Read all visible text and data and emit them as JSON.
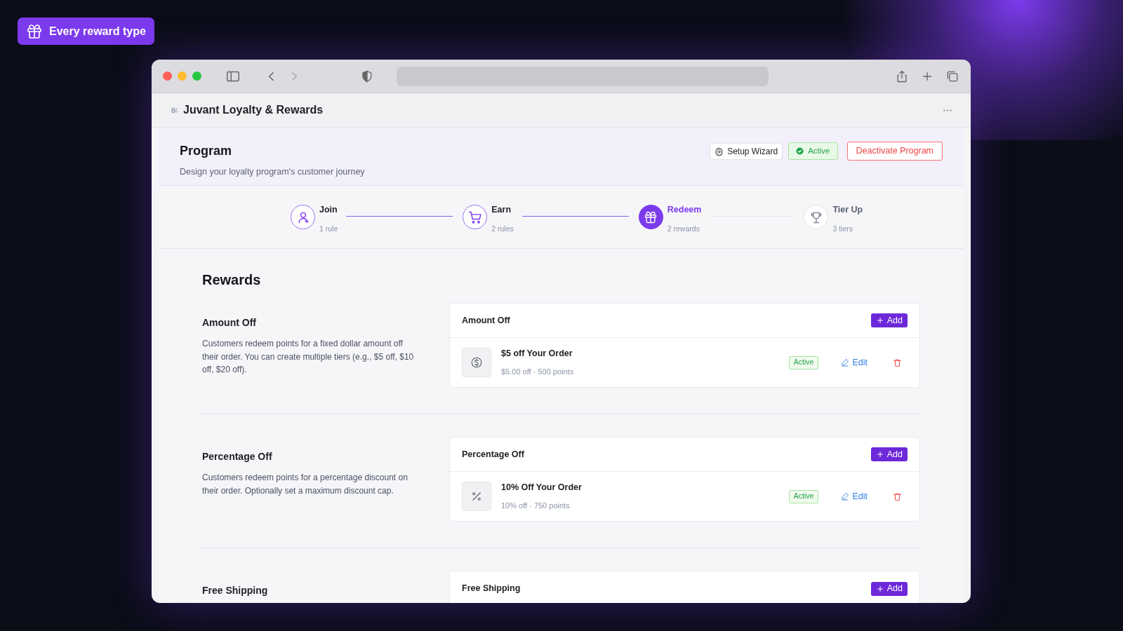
{
  "badge": {
    "label": "Every reward type"
  },
  "app": {
    "title": "Juvant Loyalty & Rewards"
  },
  "program": {
    "title": "Program",
    "subtitle": "Design your loyalty program's customer journey",
    "setup_button": "Setup Wizard",
    "status": "Active",
    "deactivate_button": "Deactivate Program"
  },
  "steps": [
    {
      "kind": "user",
      "label": "Join",
      "count": "1 rule",
      "selected": false,
      "completed": true
    },
    {
      "kind": "cart",
      "label": "Earn",
      "count": "2 rules",
      "selected": false,
      "completed": true
    },
    {
      "kind": "gift",
      "label": "Redeem",
      "count": "2 rewards",
      "selected": true,
      "completed": false
    },
    {
      "kind": "trophy",
      "label": "Tier Up",
      "count": "3 tiers",
      "selected": false,
      "completed": false
    }
  ],
  "page_title": "Rewards",
  "sections": [
    {
      "title": "Amount Off",
      "description": "Customers redeem points for a fixed dollar amount off their order. You can create multiple tiers (e.g., $5 off, $10 off, $20 off).",
      "card_title": "Amount Off",
      "add_button": "Add",
      "rewards": [
        {
          "kind": "dollar",
          "name": "$5 off Your Order",
          "detail": "$5.00 off · 500 points",
          "status": "Active",
          "edit": "Edit"
        }
      ]
    },
    {
      "title": "Percentage Off",
      "description": "Customers redeem points for a percentage discount on their order. Optionally set a maximum discount cap.",
      "card_title": "Percentage Off",
      "add_button": "Add",
      "rewards": [
        {
          "kind": "percent",
          "name": "10% Off Your Order",
          "detail": "10% off · 750 points",
          "status": "Active",
          "edit": "Edit"
        }
      ]
    },
    {
      "title": "Free Shipping",
      "card_title": "Free Shipping",
      "add_button": "Add"
    }
  ]
}
